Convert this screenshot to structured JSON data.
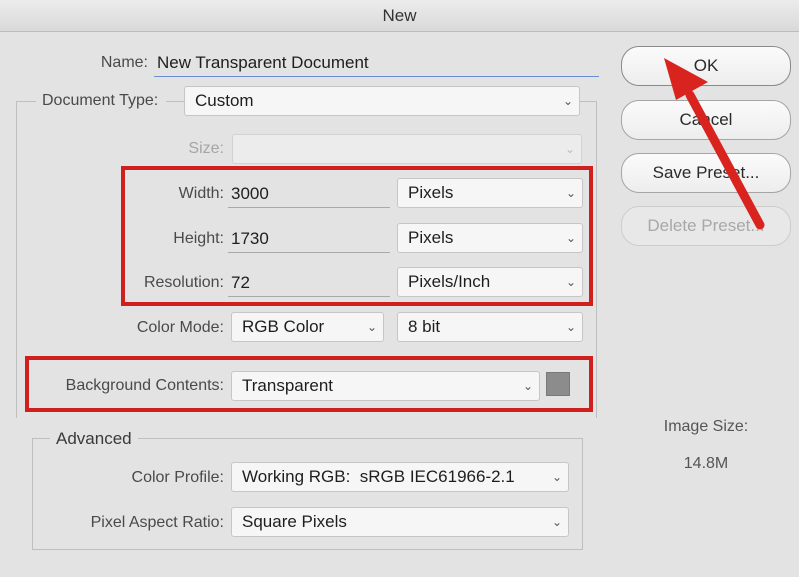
{
  "dialog": {
    "title": "New"
  },
  "name": {
    "label": "Name:",
    "value": "New Transparent Document"
  },
  "document_type": {
    "label": "Document Type:",
    "value": "Custom"
  },
  "size": {
    "label": "Size:",
    "value": ""
  },
  "width": {
    "label": "Width:",
    "value": "3000",
    "unit": "Pixels"
  },
  "height": {
    "label": "Height:",
    "value": "1730",
    "unit": "Pixels"
  },
  "resolution": {
    "label": "Resolution:",
    "value": "72",
    "unit": "Pixels/Inch"
  },
  "color_mode": {
    "label": "Color Mode:",
    "value": "RGB Color",
    "depth": "8 bit"
  },
  "background_contents": {
    "label": "Background Contents:",
    "value": "Transparent",
    "swatch_color": "#8c8c8c"
  },
  "advanced": {
    "legend": "Advanced",
    "color_profile": {
      "label": "Color Profile:",
      "value": "Working RGB:  sRGB IEC61966-2.1"
    },
    "pixel_aspect_ratio": {
      "label": "Pixel Aspect Ratio:",
      "value": "Square Pixels"
    }
  },
  "buttons": {
    "ok": "OK",
    "cancel": "Cancel",
    "save_preset": "Save Preset...",
    "delete_preset": "Delete Preset..."
  },
  "image_size": {
    "label": "Image Size:",
    "value": "14.8M"
  },
  "annotation": {
    "highlight_color": "#d0201e",
    "arrow_color": "#d8231f"
  }
}
